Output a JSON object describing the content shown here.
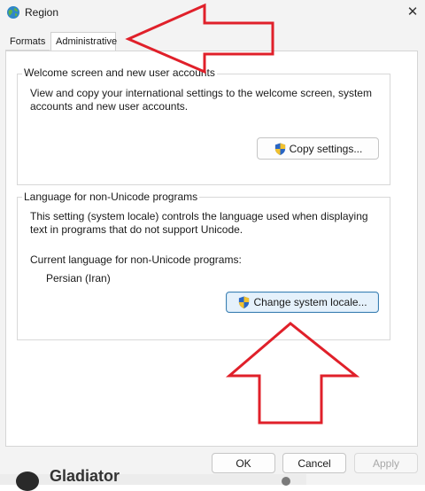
{
  "window": {
    "title": "Region",
    "close_glyph": "✕"
  },
  "tabs": [
    {
      "label": "Formats",
      "selected": false
    },
    {
      "label": "Administrative",
      "selected": true
    }
  ],
  "welcome": {
    "legend": "Welcome screen and new user accounts",
    "description": "View and copy your international settings to the welcome screen, system accounts and new user accounts.",
    "button_label": "Copy settings..."
  },
  "non_unicode": {
    "legend": "Language for non-Unicode programs",
    "description": "This setting (system locale) controls the language used when displaying text in programs that do not support Unicode.",
    "current_label": "Current language for non-Unicode programs:",
    "current_value": "Persian (Iran)",
    "button_label": "Change system locale..."
  },
  "footer": {
    "ok_label": "OK",
    "cancel_label": "Cancel",
    "apply_label": "Apply"
  },
  "annotations": {
    "arrow_color": "#e0202a"
  },
  "background_strip": {
    "text": "Gladiator"
  }
}
